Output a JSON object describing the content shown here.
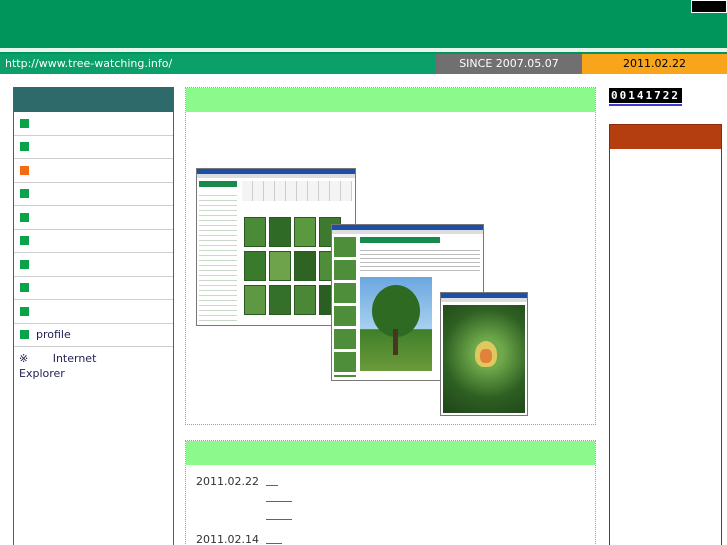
{
  "header": {
    "url": "http://www.tree-watching.info/",
    "since": "SINCE 2007.05.07",
    "date": "2011.02.22"
  },
  "nav": {
    "items": [
      {
        "label": "",
        "bullet": "green"
      },
      {
        "label": "",
        "bullet": "green"
      },
      {
        "label": "",
        "bullet": "orange"
      },
      {
        "label": "",
        "bullet": "green"
      },
      {
        "label": "",
        "bullet": "green"
      },
      {
        "label": "",
        "bullet": "green"
      },
      {
        "label": "",
        "bullet": "green"
      },
      {
        "label": "",
        "bullet": "green"
      },
      {
        "label": "",
        "bullet": "green"
      },
      {
        "label": "profile",
        "bullet": "green"
      }
    ],
    "ie_prefix": "※",
    "ie_word1": "Internet",
    "ie_word2": "Explorer"
  },
  "news": [
    {
      "date": "2011.02.22"
    },
    {
      "date": "2011.02.14"
    }
  ],
  "counter": "00141722",
  "colors": {
    "header_green": "#00955a",
    "since_gray": "#707070",
    "date_orange": "#f9a51b",
    "nav_head": "#2e6a6a",
    "panel_head": "#8cf98c",
    "right_head": "#b43e10"
  }
}
